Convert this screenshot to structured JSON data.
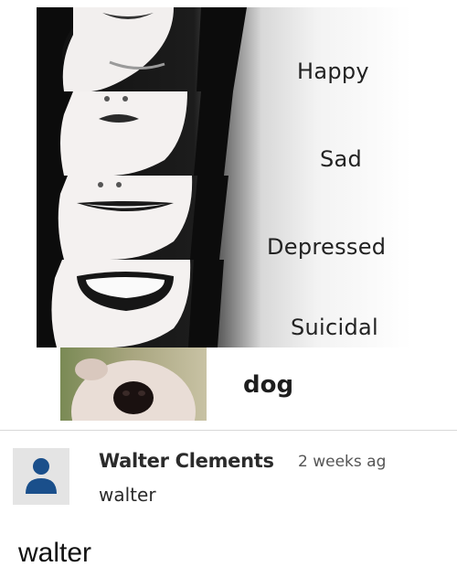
{
  "meme": {
    "moods": [
      {
        "label": "Happy"
      },
      {
        "label": "Sad"
      },
      {
        "label": "Depressed"
      },
      {
        "label": "Suicidal"
      }
    ],
    "dog_label": "dog"
  },
  "comment": {
    "author": "Walter Clements",
    "time": "2 weeks ag",
    "text": "walter",
    "avatar_icon": "default-user-avatar-icon",
    "accent": "#1a4f8b"
  },
  "caption": "walter"
}
